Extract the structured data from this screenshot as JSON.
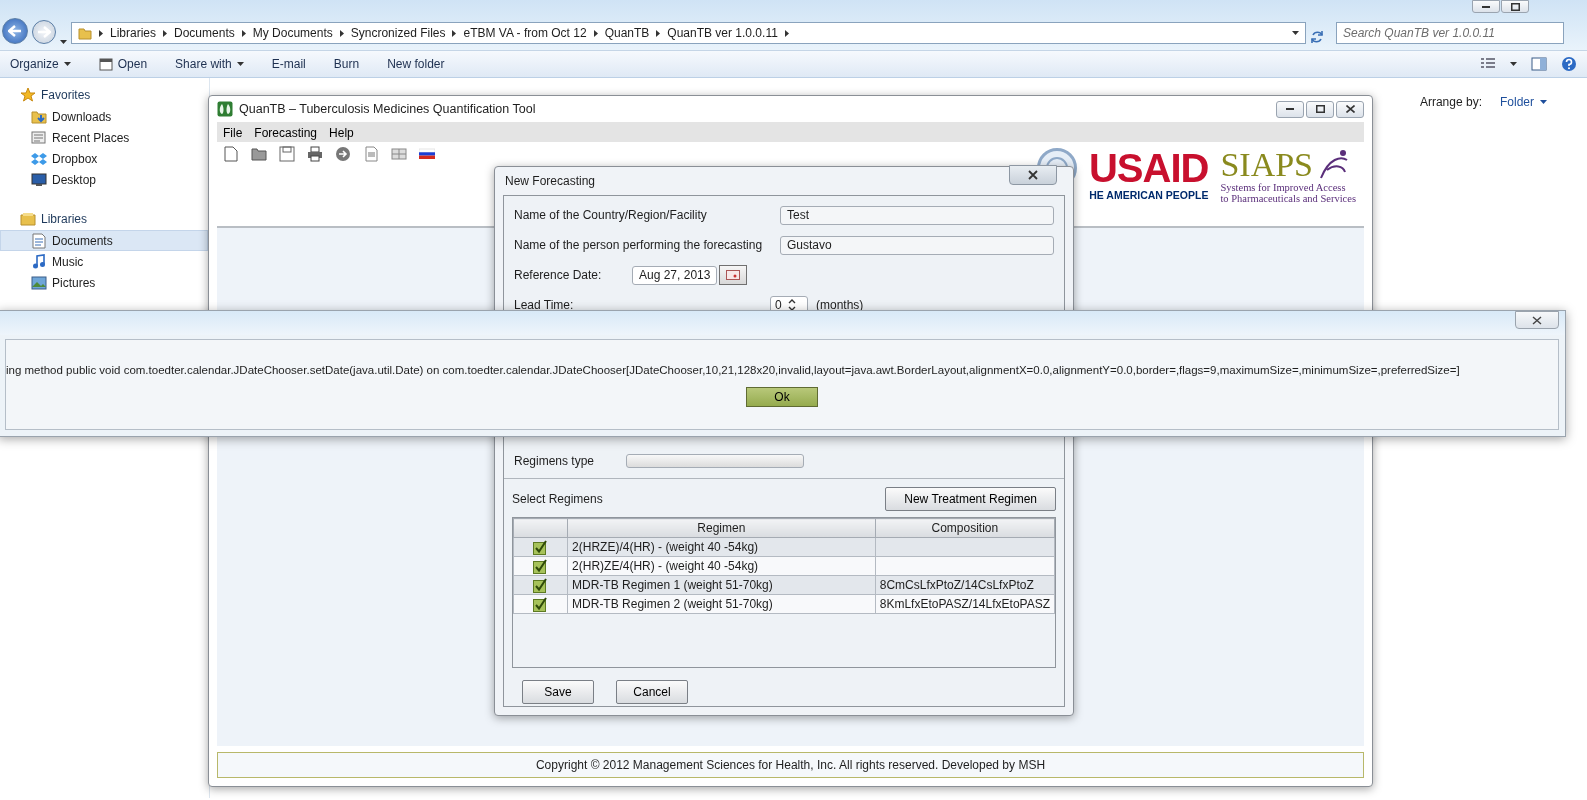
{
  "explorer": {
    "breadcrumb": [
      "Libraries",
      "Documents",
      "My Documents",
      "Syncronized Files",
      "eTBM VA - from Oct 12",
      "QuanTB",
      "QuanTB ver 1.0.0.11"
    ],
    "search": {
      "placeholder": "Search QuanTB ver 1.0.0.11"
    },
    "toolbar": [
      {
        "label": "Organize",
        "kind": "dropdown"
      },
      {
        "label": "Open",
        "kind": "icon"
      },
      {
        "label": "Share with",
        "kind": "dropdown"
      },
      {
        "label": "E-mail",
        "kind": "plain"
      },
      {
        "label": "Burn",
        "kind": "plain"
      },
      {
        "label": "New folder",
        "kind": "plain"
      }
    ],
    "sidebar": [
      {
        "label": "Favorites",
        "items": [
          {
            "label": "Downloads",
            "selected": false
          },
          {
            "label": "Recent Places",
            "selected": false
          },
          {
            "label": "Dropbox",
            "selected": false
          },
          {
            "label": "Desktop",
            "selected": false
          }
        ]
      },
      {
        "label": "Libraries",
        "items": [
          {
            "label": "Documents",
            "selected": true
          },
          {
            "label": "Music",
            "selected": false
          },
          {
            "label": "Pictures",
            "selected": false
          }
        ]
      }
    ],
    "arrange": {
      "label": "Arrange by:",
      "value": "Folder"
    }
  },
  "app": {
    "title": "QuanTB – Tuberculosis Medicines Quantification Tool",
    "menu": [
      "File",
      "Forecasting",
      "Help"
    ],
    "logos": {
      "usaid": "USAID",
      "usaid_tagline": "HE AMERICAN PEOPLE",
      "siaps": "SIAPS",
      "siaps_tagline": [
        "Systems for Improved Access",
        "to Pharmaceuticals and Services"
      ]
    },
    "copyright": "Copyright © 2012 Management Sciences for Health, Inc. All rights reserved. Developed by MSH"
  },
  "dialog": {
    "title": "New Forecasting",
    "fields": [
      {
        "kind": "text",
        "label": "Name of the Country/Region/Facility",
        "value": "Test"
      },
      {
        "kind": "text",
        "label": "Name of the person performing the forecasting",
        "value": "Gustavo"
      },
      {
        "kind": "date",
        "label": "Reference Date:",
        "value": "Aug 27, 2013"
      },
      {
        "kind": "spinner",
        "label": "Lead Time:",
        "value": "0",
        "unit": "(months)"
      },
      {
        "kind": "select",
        "label": "Regimens type"
      }
    ],
    "regimens": {
      "label": "Select Regimens",
      "new_button": "New Treatment Regimen",
      "columns": [
        "Regimen",
        "Composition"
      ],
      "rows": [
        {
          "checked": true,
          "regimen": "2(HRZE)/4(HR) - (weight 40 -54kg)",
          "composition": ""
        },
        {
          "checked": true,
          "regimen": "2(HR)ZE/4(HR) - (weight 40 -54kg)",
          "composition": ""
        },
        {
          "checked": true,
          "regimen": "MDR-TB Regimen 1 (weight 51-70kg)",
          "composition": "8CmCsLfxPtoZ/14CsLfxPtoZ"
        },
        {
          "checked": true,
          "regimen": "MDR-TB Regimen 2 (weight 51-70kg)",
          "composition": "8KmLfxEtoPASZ/14LfxEtoPASZ"
        }
      ]
    },
    "buttons": [
      "Save",
      "Cancel"
    ]
  },
  "error": {
    "message": "ing method public void com.toedter.calendar.JDateChooser.setDate(java.util.Date) on com.toedter.calendar.JDateChooser[JDateChooser,10,21,128x20,invalid,layout=java.awt.BorderLayout,alignmentX=0.0,alignmentY=0.0,border=,flags=9,maximumSize=,minimumSize=,preferredSize=]",
    "button": "Ok"
  }
}
